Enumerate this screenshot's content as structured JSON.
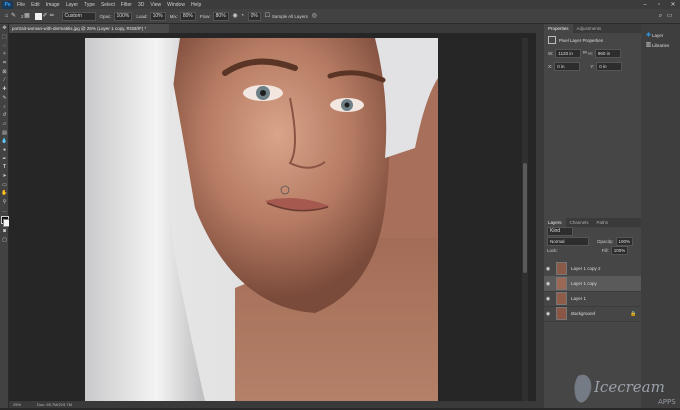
{
  "menu": [
    "File",
    "Edit",
    "Image",
    "Layer",
    "Type",
    "Select",
    "Filter",
    "3D",
    "View",
    "Window",
    "Help"
  ],
  "app_logo": "Ps",
  "options": {
    "brush_size": "2",
    "mode_label": "Mode:",
    "mode_value": "Custom",
    "opacity_label": "Opac:",
    "opacity_value": "100%",
    "flow_label": "Flow:",
    "flow_value": "30%",
    "load_label": "Load:",
    "load_value": "10%",
    "mix_label": "Mix:",
    "mix_value": "80%",
    "flow2_label": "Flow:",
    "flow2_value": "80%",
    "smoothing_value": "0%",
    "sample_label": "Sample All Layers"
  },
  "document": {
    "tab_title": "portrait-woman-with-dermatitis.jpg @ 25% (Layer 1 copy, RGB/8*) *",
    "zoom": "25%",
    "doc_size": "Doc: 65.7M/219.7M"
  },
  "properties": {
    "tabs": [
      "Properties",
      "Adjustments"
    ],
    "section": "Pixel Layer Properties",
    "w_label": "W:",
    "w_value": "1120 in",
    "h_label": "H:",
    "h_value": "960 in",
    "x_label": "X:",
    "x_value": "0 in",
    "y_label": "Y:",
    "y_value": "0 in"
  },
  "layers": {
    "tabs": [
      "Layers",
      "Channels",
      "Paths"
    ],
    "kind_label": "Kind",
    "blend_mode": "Normal",
    "opacity_label": "Opacity:",
    "opacity_value": "100%",
    "lock_label": "Lock:",
    "fill_label": "Fill:",
    "fill_value": "100%",
    "items": [
      {
        "name": "Layer 1 copy 2"
      },
      {
        "name": "Layer 1 copy"
      },
      {
        "name": "Layer 1"
      },
      {
        "name": "Background"
      }
    ]
  },
  "right_panel": {
    "items": [
      "Layer",
      "Libraries"
    ]
  },
  "watermark": {
    "brand": "Icecream",
    "sub": "APPS"
  },
  "colors": {
    "accent": "#31a8ff",
    "panel": "#464646",
    "selected_layer": "#5a5a5a"
  }
}
